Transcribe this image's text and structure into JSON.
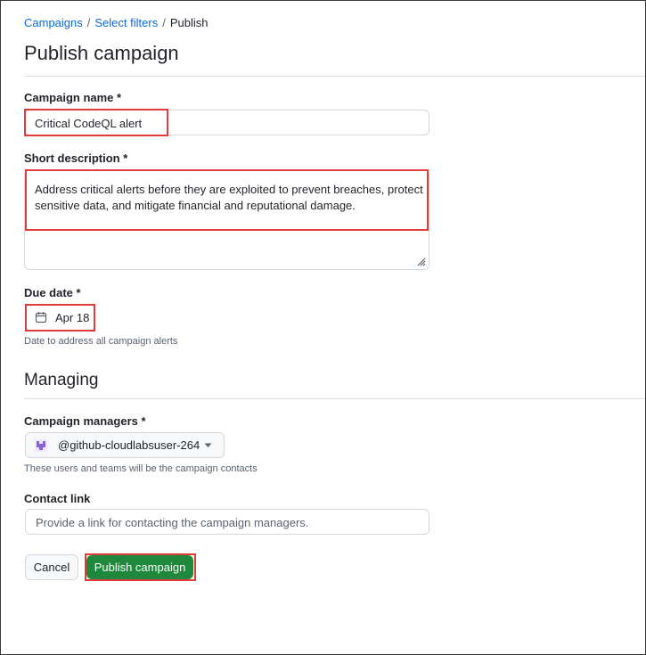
{
  "breadcrumb": {
    "items": [
      "Campaigns",
      "Select filters"
    ],
    "separator": "/",
    "current": "Publish"
  },
  "page": {
    "title": "Publish campaign"
  },
  "form": {
    "campaign_name": {
      "label": "Campaign name *",
      "value": "Critical CodeQL alert"
    },
    "short_description": {
      "label": "Short description *",
      "value_line1": "Address critical alerts before they are exploited to prevent breaches, protect",
      "value_line2": "sensitive data, and mitigate financial and reputational damage."
    },
    "due_date": {
      "label": "Due date *",
      "value": "Apr 18",
      "hint": "Date to address all campaign alerts",
      "icon": "calendar-icon"
    },
    "managing": {
      "heading": "Managing",
      "managers_label": "Campaign managers *",
      "manager_value": "@github-cloudlabsuser-264",
      "managers_hint": "These users and teams will be the campaign contacts",
      "contact_label": "Contact link",
      "contact_placeholder": "Provide a link for contacting the campaign managers."
    }
  },
  "actions": {
    "cancel": "Cancel",
    "publish": "Publish campaign"
  },
  "colors": {
    "accent": "#0969da",
    "primary_button": "#1f883d",
    "highlight": "#e03c3c",
    "avatar": "#8a63d2"
  }
}
